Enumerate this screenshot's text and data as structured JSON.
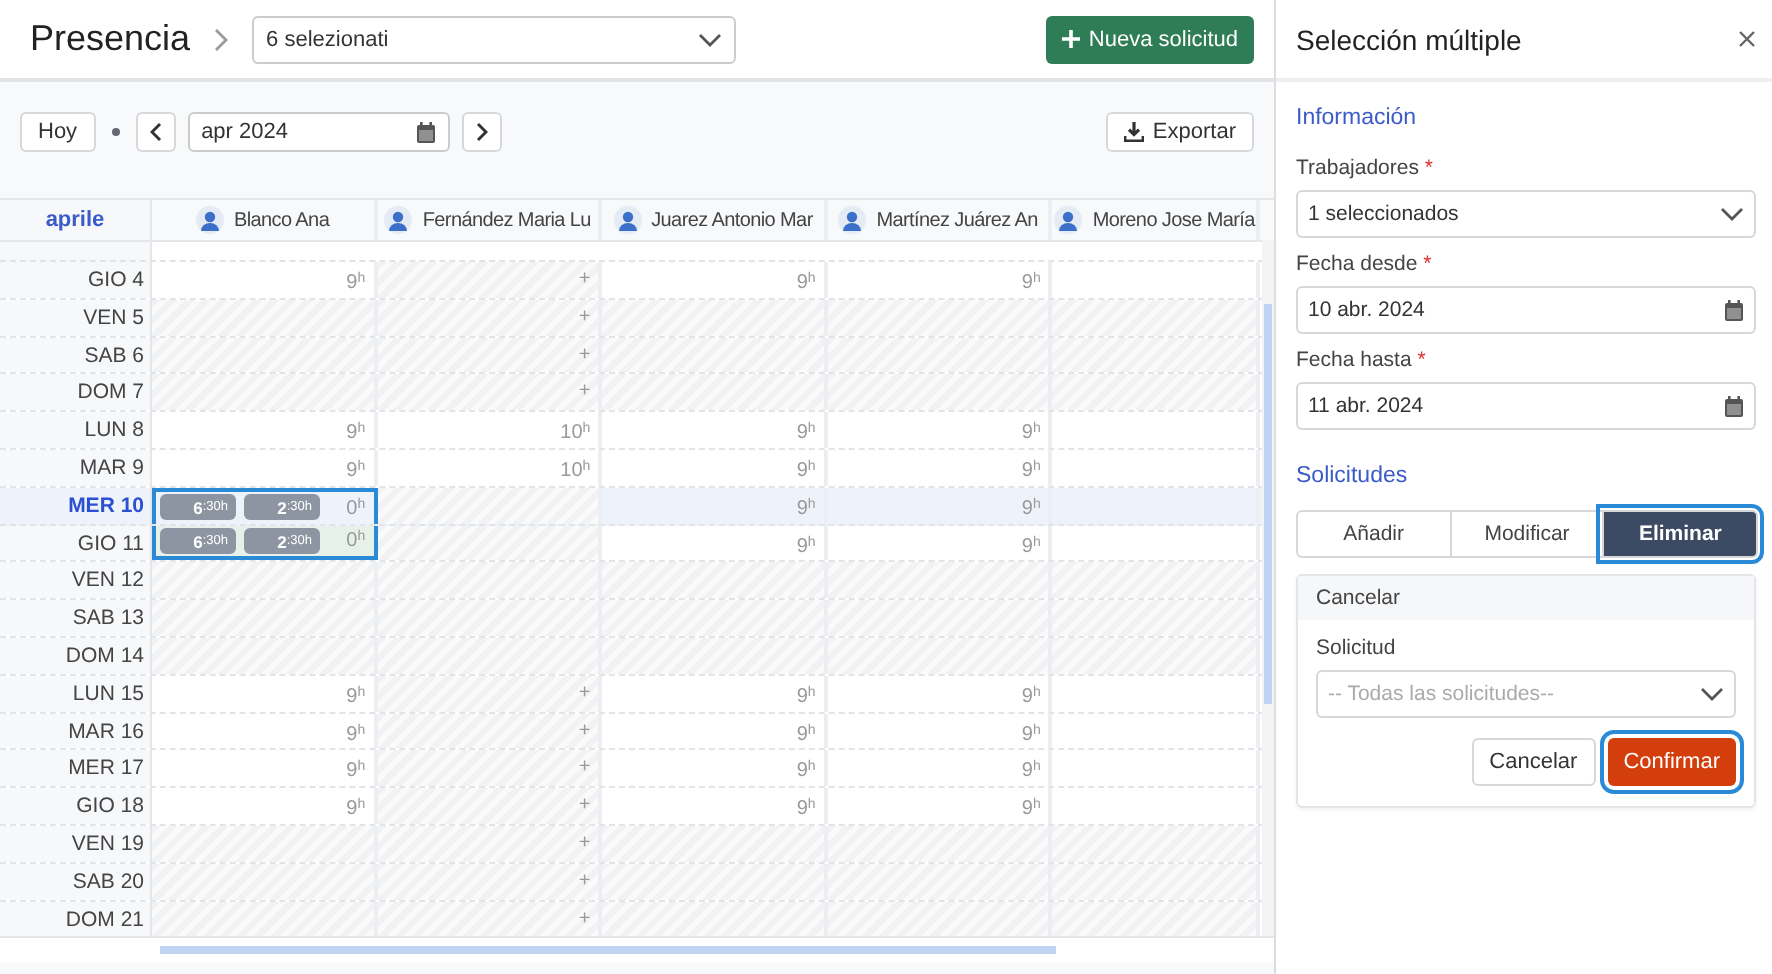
{
  "header": {
    "title": "Presencia",
    "selector": "6 selezionati",
    "new_button": "Nueva solicitud"
  },
  "toolbar": {
    "today": "Hoy",
    "month": "apr 2024",
    "export": "Exportar"
  },
  "grid": {
    "month_label": "aprile",
    "columns": [
      {
        "name": "Blanco Ana"
      },
      {
        "name": "Fernández Maria Lu"
      },
      {
        "name": "Juarez Antonio Mar"
      },
      {
        "name": "Martínez Juárez An"
      },
      {
        "name": "Moreno Jose María"
      }
    ],
    "rows": [
      {
        "day": "GIO 4",
        "today": false,
        "cells": [
          {
            "kind": "hours",
            "text": "9$^{h}$",
            "hatched": false
          },
          {
            "kind": "hours",
            "text": "+",
            "hatched": true
          },
          {
            "kind": "hours",
            "text": "9$^{h}$",
            "hatched": false
          },
          {
            "kind": "hours",
            "text": "9$^{h}$",
            "hatched": false
          },
          {
            "kind": "hours",
            "hatched": false
          }
        ]
      },
      {
        "day": "VEN 5",
        "today": false,
        "cells": [
          {
            "kind": "hours",
            "hatched": true
          },
          {
            "kind": "hours",
            "text": "+",
            "hatched": true
          },
          {
            "kind": "hours",
            "hatched": true
          },
          {
            "kind": "hours",
            "hatched": true
          },
          {
            "kind": "hours",
            "hatched": true
          }
        ]
      },
      {
        "day": "SAB 6",
        "today": false,
        "cells": [
          {
            "kind": "hours",
            "hatched": true
          },
          {
            "kind": "hours",
            "text": "+",
            "hatched": true
          },
          {
            "kind": "hours",
            "hatched": true
          },
          {
            "kind": "hours",
            "hatched": true
          },
          {
            "kind": "hours",
            "hatched": true
          }
        ]
      },
      {
        "day": "DOM 7",
        "today": false,
        "cells": [
          {
            "kind": "hours",
            "hatched": true
          },
          {
            "kind": "hours",
            "text": "+",
            "hatched": true
          },
          {
            "kind": "hours",
            "hatched": true
          },
          {
            "kind": "hours",
            "hatched": true
          },
          {
            "kind": "hours",
            "hatched": true
          }
        ]
      },
      {
        "day": "LUN 8",
        "today": false,
        "cells": [
          {
            "kind": "hours",
            "text": "9$^{h}$",
            "hatched": false
          },
          {
            "kind": "hours",
            "text": "10$^{h}$",
            "hatched": false
          },
          {
            "kind": "hours",
            "text": "9$^{h}$",
            "hatched": false
          },
          {
            "kind": "hours",
            "text": "9$^{h}$",
            "hatched": false
          },
          {
            "kind": "hours",
            "hatched": false
          }
        ]
      },
      {
        "day": "MAR 9",
        "today": false,
        "cells": [
          {
            "kind": "hours",
            "text": "9$^{h}$",
            "hatched": false
          },
          {
            "kind": "hours",
            "text": "10$^{h}$",
            "hatched": false
          },
          {
            "kind": "hours",
            "text": "9$^{h}$",
            "hatched": false
          },
          {
            "kind": "hours",
            "text": "9$^{h}$",
            "hatched": false
          },
          {
            "kind": "hours",
            "hatched": false
          }
        ]
      },
      {
        "day": "MER 10",
        "today": true,
        "cells": [
          {
            "kind": "request",
            "chips": [
              "6$^{:30h}$",
              "2$^{:30h}$"
            ],
            "text": "0$^{h}$",
            "tinted": false,
            "hatched": false
          },
          {
            "kind": "hours",
            "hatched": true
          },
          {
            "kind": "hours",
            "text": "9$^{h}$",
            "hatched": false
          },
          {
            "kind": "hours",
            "text": "9$^{h}$",
            "hatched": false
          },
          {
            "kind": "hours",
            "hatched": false
          }
        ]
      },
      {
        "day": "GIO 11",
        "today": false,
        "cells": [
          {
            "kind": "request",
            "chips": [
              "6$^{:30h}$",
              "2$^{:30h}$"
            ],
            "text": "0$^{h}$",
            "tinted": true,
            "hatched": false
          },
          {
            "kind": "hours",
            "hatched": true
          },
          {
            "kind": "hours",
            "text": "9$^{h}$",
            "hatched": false
          },
          {
            "kind": "hours",
            "text": "9$^{h}$",
            "hatched": false
          },
          {
            "kind": "hours",
            "hatched": false
          }
        ]
      },
      {
        "day": "VEN 12",
        "today": false,
        "cells": [
          {
            "kind": "hours",
            "hatched": true
          },
          {
            "kind": "hours",
            "hatched": true
          },
          {
            "kind": "hours",
            "hatched": true
          },
          {
            "kind": "hours",
            "hatched": true
          },
          {
            "kind": "hours",
            "hatched": true
          }
        ]
      },
      {
        "day": "SAB 13",
        "today": false,
        "cells": [
          {
            "kind": "hours",
            "hatched": true
          },
          {
            "kind": "hours",
            "hatched": true
          },
          {
            "kind": "hours",
            "hatched": true
          },
          {
            "kind": "hours",
            "hatched": true
          },
          {
            "kind": "hours",
            "hatched": true
          }
        ]
      },
      {
        "day": "DOM 14",
        "today": false,
        "cells": [
          {
            "kind": "hours",
            "hatched": true
          },
          {
            "kind": "hours",
            "hatched": true
          },
          {
            "kind": "hours",
            "hatched": true
          },
          {
            "kind": "hours",
            "hatched": true
          },
          {
            "kind": "hours",
            "hatched": true
          }
        ]
      },
      {
        "day": "LUN 15",
        "today": false,
        "cells": [
          {
            "kind": "hours",
            "text": "9$^{h}$",
            "hatched": false
          },
          {
            "kind": "hours",
            "text": "+",
            "hatched": true
          },
          {
            "kind": "hours",
            "text": "9$^{h}$",
            "hatched": false
          },
          {
            "kind": "hours",
            "text": "9$^{h}$",
            "hatched": false
          },
          {
            "kind": "hours",
            "hatched": false
          }
        ]
      },
      {
        "day": "MAR 16",
        "today": false,
        "cells": [
          {
            "kind": "hours",
            "text": "9$^{h}$",
            "hatched": false
          },
          {
            "kind": "hours",
            "text": "+",
            "hatched": true
          },
          {
            "kind": "hours",
            "text": "9$^{h}$",
            "hatched": false
          },
          {
            "kind": "hours",
            "text": "9$^{h}$",
            "hatched": false
          },
          {
            "kind": "hours",
            "hatched": false
          }
        ]
      },
      {
        "day": "MER 17",
        "today": false,
        "cells": [
          {
            "kind": "hours",
            "text": "9$^{h}$",
            "hatched": false
          },
          {
            "kind": "hours",
            "text": "+",
            "hatched": true
          },
          {
            "kind": "hours",
            "text": "9$^{h}$",
            "hatched": false
          },
          {
            "kind": "hours",
            "text": "9$^{h}$",
            "hatched": false
          },
          {
            "kind": "hours",
            "hatched": false
          }
        ]
      },
      {
        "day": "GIO 18",
        "today": false,
        "cells": [
          {
            "kind": "hours",
            "text": "9$^{h}$",
            "hatched": false
          },
          {
            "kind": "hours",
            "text": "+",
            "hatched": true
          },
          {
            "kind": "hours",
            "text": "9$^{h}$",
            "hatched": false
          },
          {
            "kind": "hours",
            "text": "9$^{h}$",
            "hatched": false
          },
          {
            "kind": "hours",
            "hatched": false
          }
        ]
      },
      {
        "day": "VEN 19",
        "today": false,
        "cells": [
          {
            "kind": "hours",
            "hatched": true
          },
          {
            "kind": "hours",
            "text": "+",
            "hatched": true
          },
          {
            "kind": "hours",
            "hatched": true
          },
          {
            "kind": "hours",
            "hatched": true
          },
          {
            "kind": "hours",
            "hatched": true
          }
        ]
      },
      {
        "day": "SAB 20",
        "today": false,
        "cells": [
          {
            "kind": "hours",
            "hatched": true
          },
          {
            "kind": "hours",
            "text": "+",
            "hatched": true
          },
          {
            "kind": "hours",
            "hatched": true
          },
          {
            "kind": "hours",
            "hatched": true
          },
          {
            "kind": "hours",
            "hatched": true
          }
        ]
      },
      {
        "day": "DOM 21",
        "today": false,
        "cells": [
          {
            "kind": "hours",
            "hatched": true
          },
          {
            "kind": "hours",
            "text": "+",
            "hatched": true
          },
          {
            "kind": "hours",
            "hatched": true
          },
          {
            "kind": "hours",
            "hatched": true
          },
          {
            "kind": "hours",
            "hatched": true
          }
        ]
      }
    ]
  },
  "panel": {
    "title": "Selección múltiple",
    "info_heading": "Información",
    "fields": [
      {
        "label": "Trabajadores",
        "mark": "*",
        "value": "1 seleccionados",
        "kind": "select"
      },
      {
        "label": "Fecha desde",
        "mark": "*",
        "value": "10 abr. 2024",
        "kind": "date"
      },
      {
        "label": "Fecha hasta",
        "mark": "*",
        "value": "11 abr. 2024",
        "kind": "date"
      }
    ],
    "requests_heading": "Solicitudes",
    "modes": [
      {
        "label": "Añadir",
        "selected": false
      },
      {
        "label": "Modificar",
        "selected": false
      },
      {
        "label": "Eliminar",
        "selected": true
      }
    ],
    "card": {
      "title": "Cancelar",
      "label": "Solicitud",
      "placeholder": "-- Todas las solicitudes--",
      "cancel": "Cancelar",
      "confirm": "Confirmar"
    }
  }
}
